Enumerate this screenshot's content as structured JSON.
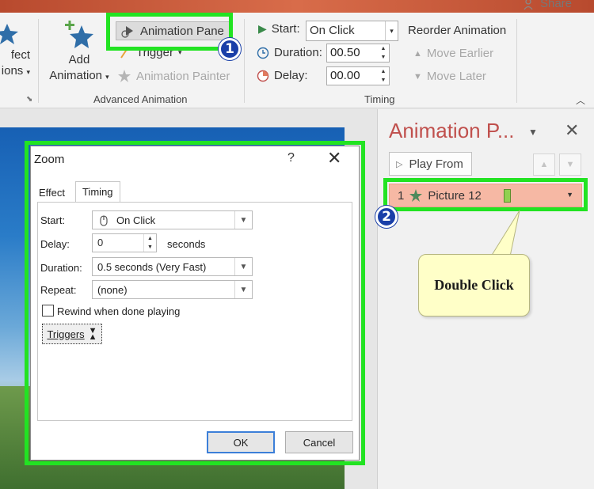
{
  "ribbon": {
    "share_label": "Share",
    "effect_options_label_1": "fect",
    "effect_options_label_2": "ions",
    "add_animation_label_1": "Add",
    "add_animation_label_2": "Animation",
    "animation_pane_label": "Animation Pane",
    "trigger_label": "Trigger",
    "animation_painter_label": "Animation Painter",
    "advanced_animation_group": "Advanced Animation",
    "start_label": "Start:",
    "start_value": "On Click",
    "duration_label": "Duration:",
    "duration_value": "00.50",
    "delay_label": "Delay:",
    "delay_value": "00.00",
    "timing_group": "Timing",
    "reorder_label": "Reorder Animation",
    "move_earlier_label": "Move Earlier",
    "move_later_label": "Move Later"
  },
  "callouts": {
    "step1": "1",
    "step2": "2",
    "double_click_text": "Double Click"
  },
  "animation_pane": {
    "title": "Animation P...",
    "play_from_label": "Play From",
    "item": {
      "index": "1",
      "name": "Picture 12"
    }
  },
  "dialog": {
    "title": "Zoom",
    "help": "?",
    "tabs": [
      "Effect",
      "Timing"
    ],
    "start_label": "Start:",
    "start_value": "On Click",
    "delay_label": "Delay:",
    "delay_value": "0",
    "delay_unit": "seconds",
    "duration_label": "Duration:",
    "duration_value": "0.5 seconds (Very Fast)",
    "repeat_label": "Repeat:",
    "repeat_value": "(none)",
    "rewind_label": "Rewind when done playing",
    "triggers_label": "Triggers",
    "ok_label": "OK",
    "cancel_label": "Cancel"
  },
  "colors": {
    "highlight_green": "#22e322",
    "pane_title": "#c0504d",
    "callout_badge": "#1a3fa8",
    "selected_item": "#f6b8a4",
    "timing_bar": "#92d050"
  }
}
